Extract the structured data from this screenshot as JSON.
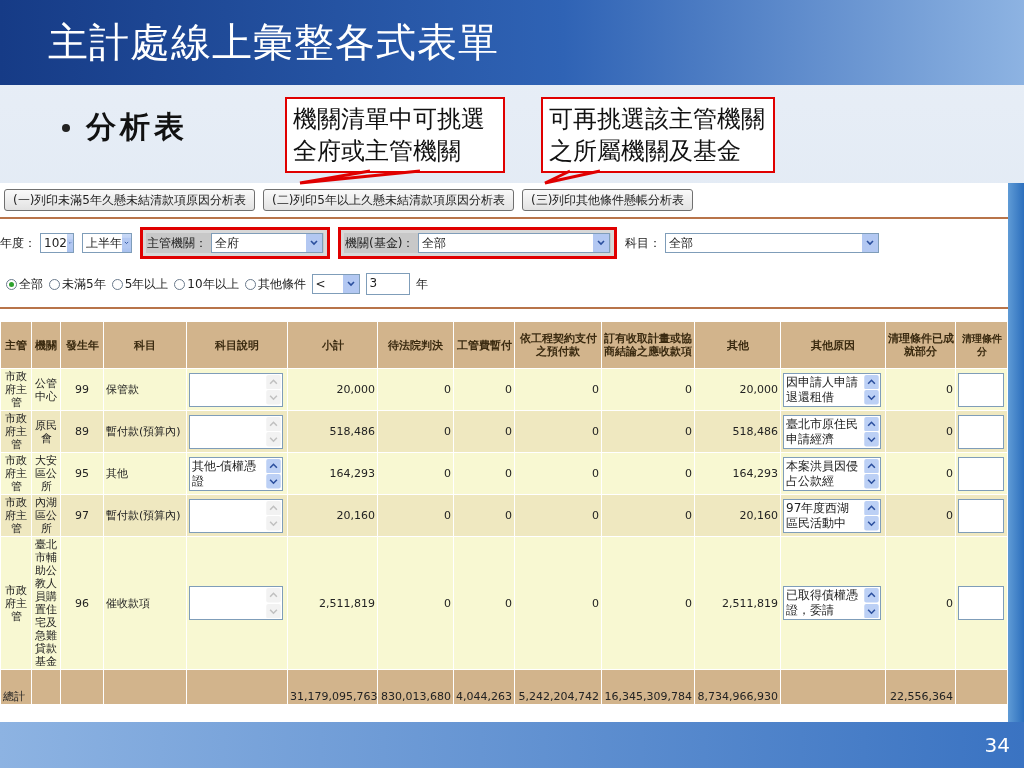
{
  "slide": {
    "title": "主計處線上彙整各式表單",
    "bullet": "分析表",
    "page_number": "34"
  },
  "callouts": [
    {
      "text": "機關清單中可挑選全府或主管機關"
    },
    {
      "text": "可再挑選該主管機關之所屬機關及基金"
    }
  ],
  "report_buttons": [
    "(一)列印未滿5年久懸未結清款項原因分析表",
    "(二)列印5年以上久懸未結清款項原因分析表",
    "(三)列印其他條件懸帳分析表"
  ],
  "filters": [
    {
      "label": "年度：",
      "value": "102",
      "highlighted": false
    },
    {
      "value": "上半年",
      "highlighted": false
    },
    {
      "label": "主管機關：",
      "value": "全府",
      "highlighted": true
    },
    {
      "label": "機關(基金)：",
      "value": "全部",
      "highlighted": true
    },
    {
      "label": "科目：",
      "value": "全部",
      "highlighted": false
    }
  ],
  "age_options": [
    {
      "label": "全部",
      "selected": true
    },
    {
      "label": "未滿5年",
      "selected": false
    },
    {
      "label": "5年以上",
      "selected": false
    },
    {
      "label": "10年以上",
      "selected": false
    },
    {
      "label": "其他條件",
      "selected": false
    }
  ],
  "other_condition": {
    "operator": "<",
    "years": "3",
    "unit": "年"
  },
  "table": {
    "columns": [
      "主管",
      "機關",
      "發生年",
      "科目",
      "科目說明",
      "小計",
      "待法院判決",
      "工管費暫付",
      "依工程契約支付之預付款",
      "訂有收取計畫或協商結論之應收款項",
      "其他",
      "其他原因",
      "清理條件已成就部分",
      "清理條件分"
    ],
    "rows": [
      {
        "authority": "市政府主管",
        "agency": "公管中心",
        "year": "99",
        "subject": "保管款",
        "subtotal": "20,000",
        "court": "0",
        "mgmt_advance": "0",
        "prepayment": "0",
        "planned": "0",
        "other": "20,000",
        "other_reason": "因申請人申請退還租借",
        "achieved": "0"
      },
      {
        "authority": "市政府主管",
        "agency": "原民會",
        "year": "89",
        "subject": "暫付款(預算內)",
        "subtotal": "518,486",
        "court": "0",
        "mgmt_advance": "0",
        "prepayment": "0",
        "planned": "0",
        "other": "518,486",
        "other_reason": "臺北市原住民申請經濟",
        "achieved": "0"
      },
      {
        "authority": "市政府主管",
        "agency": "大安區公所",
        "year": "95",
        "subject": "其他",
        "subject_note": "其他-債權憑證",
        "subtotal": "164,293",
        "court": "0",
        "mgmt_advance": "0",
        "prepayment": "0",
        "planned": "0",
        "other": "164,293",
        "other_reason": "本案洪員因侵占公款經",
        "achieved": "0"
      },
      {
        "authority": "市政府主管",
        "agency": "內湖區公所",
        "year": "97",
        "subject": "暫付款(預算內)",
        "subtotal": "20,160",
        "court": "0",
        "mgmt_advance": "0",
        "prepayment": "0",
        "planned": "0",
        "other": "20,160",
        "other_reason": "97年度西湖區民活動中",
        "achieved": "0"
      },
      {
        "authority": "市政府主管",
        "agency": "臺北市輔助公教人員購置住宅及急難貸款基金",
        "year": "96",
        "subject": "催收款項",
        "subtotal": "2,511,819",
        "court": "0",
        "mgmt_advance": "0",
        "prepayment": "0",
        "planned": "0",
        "other": "2,511,819",
        "other_reason": "已取得債權憑證，委請",
        "achieved": "0"
      }
    ],
    "total": {
      "label": "總計",
      "subtotal": "31,179,095,763",
      "court": "830,013,680",
      "mgmt_advance": "4,044,263",
      "prepayment": "5,242,204,742",
      "planned": "16,345,309,784",
      "other": "8,734,966,930",
      "achieved": "22,556,364"
    }
  }
}
